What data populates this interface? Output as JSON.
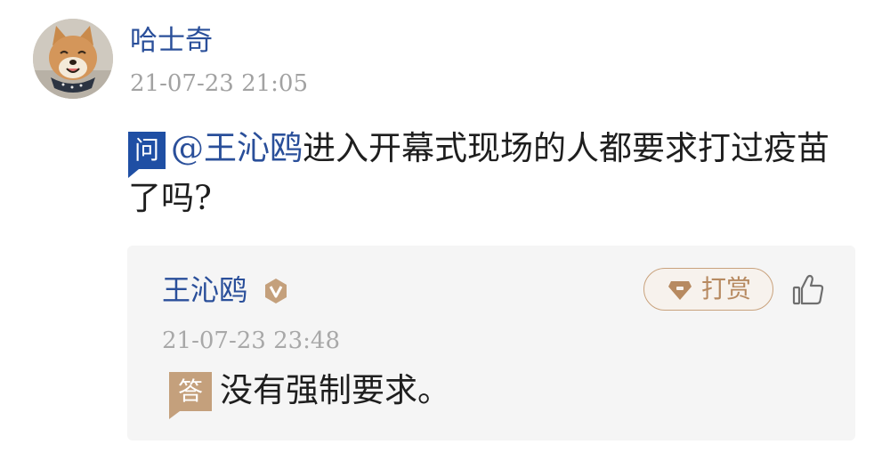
{
  "question": {
    "asker": {
      "avatar_icon": "shiba-dog-avatar",
      "name": "哈士奇",
      "time": "21-07-23 21:05"
    },
    "badge": "问",
    "mention": "@王沁鸥",
    "text": "进入开幕式现场的人都要求打过疫苗了吗?"
  },
  "answer": {
    "answerer": {
      "name": "王沁鸥",
      "verified_icon": "verified-v-icon",
      "time": "21-07-23 23:48"
    },
    "tip_button": {
      "icon": "gem-icon",
      "label": "打赏"
    },
    "like_icon": "thumbs-up-icon",
    "badge": "答",
    "text": "没有强制要求。"
  },
  "colors": {
    "link_blue": "#2a4f9a",
    "question_badge": "#1f4fa4",
    "answer_badge": "#c4a07c",
    "tip_accent": "#b78a61",
    "card_bg": "#f5f5f5",
    "meta_gray": "#a2a2a2"
  }
}
